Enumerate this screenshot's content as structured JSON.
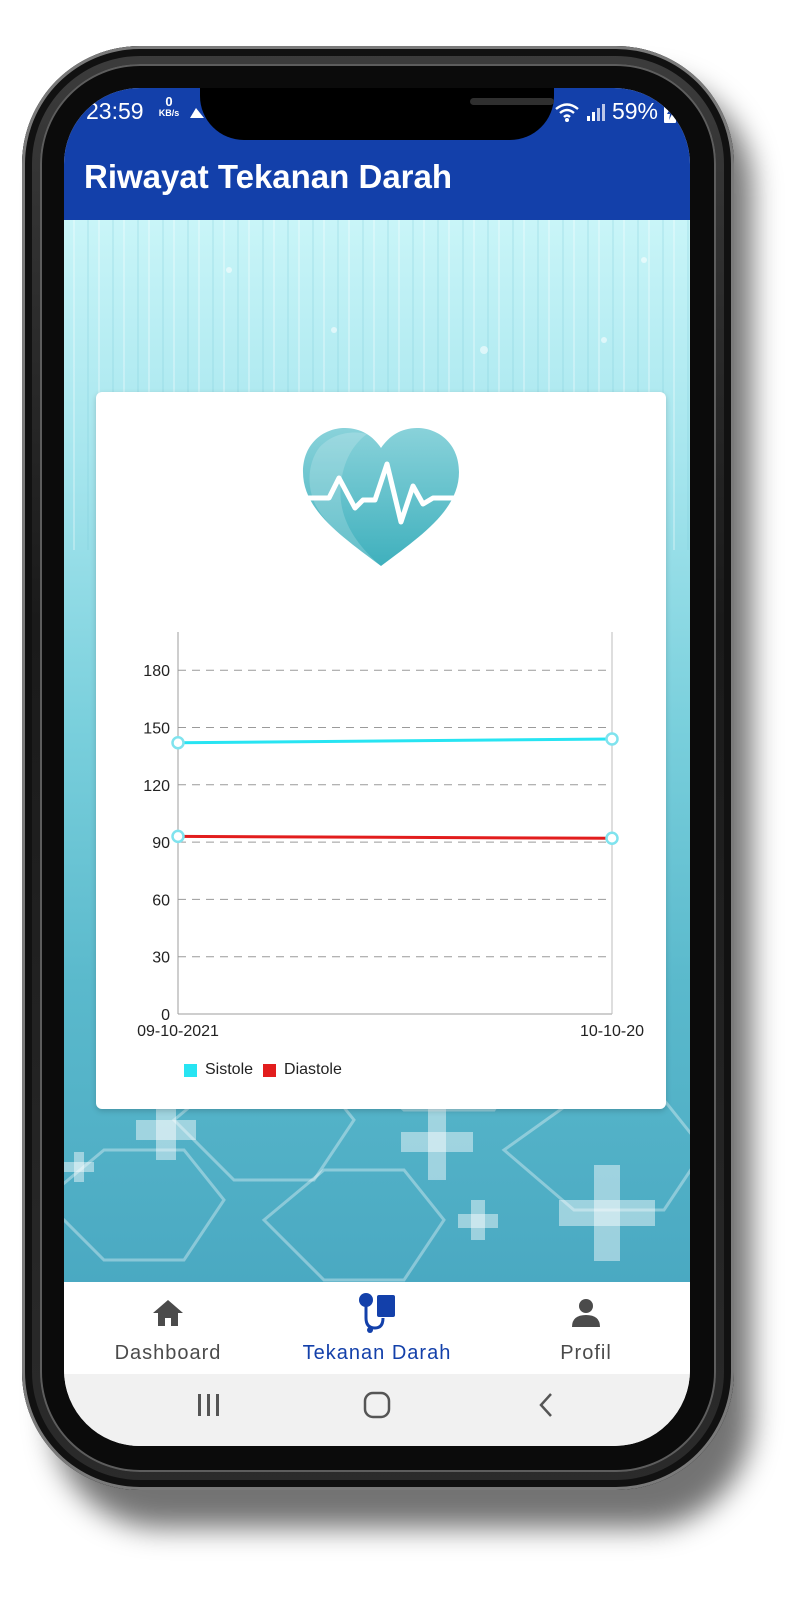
{
  "status_bar": {
    "time": "23:59",
    "net_speed_value": "0",
    "net_speed_unit": "KB/s",
    "battery": "59%"
  },
  "app_bar": {
    "title": "Riwayat Tekanan Darah"
  },
  "chart_data": {
    "type": "line",
    "x": [
      "09-10-2021",
      "10-10-20"
    ],
    "series": [
      {
        "name": "Sistole",
        "values": [
          142,
          144
        ],
        "color": "#27e4f2"
      },
      {
        "name": "Diastole",
        "values": [
          93,
          92
        ],
        "color": "#e21d1d"
      }
    ],
    "ylim": [
      0,
      200
    ],
    "yticks": [
      0,
      30,
      60,
      90,
      120,
      150,
      180
    ],
    "grid": "horizontal-dashed",
    "legend_position": "bottom-left"
  },
  "bottom_nav": {
    "active_color": "#1340aa",
    "inactive_color": "#4b4b4b",
    "items": [
      {
        "label": "Dashboard",
        "icon": "home-icon"
      },
      {
        "label": "Tekanan Darah",
        "icon": "blood-pressure-icon"
      },
      {
        "label": "Profil",
        "icon": "person-icon"
      }
    ]
  }
}
